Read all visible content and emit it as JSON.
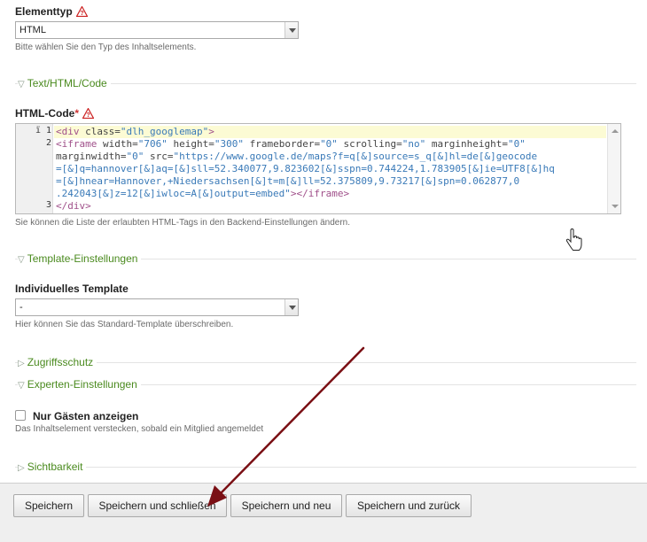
{
  "element_type": {
    "label": "Elementtyp",
    "value": "HTML",
    "help": "Bitte wählen Sie den Typ des Inhaltselements."
  },
  "sections": {
    "text_html": "Text/HTML/Code",
    "template": "Template-Einstellungen",
    "access": "Zugriffsschutz",
    "expert": "Experten-Einstellungen",
    "visibility": "Sichtbarkeit"
  },
  "html_code": {
    "label": "HTML-Code",
    "required_mark": "*",
    "help": "Sie können die Liste der erlaubten HTML-Tags in den Backend-Einstellungen ändern.",
    "gutter_marker": "ï 1",
    "line_numbers": [
      "2",
      "3"
    ]
  },
  "code": {
    "l1_open": "<div ",
    "l1_attr": "class=",
    "l1_val": "\"dlh_googlemap\"",
    "l1_close": ">",
    "l2a": "<iframe ",
    "l2b": "width=",
    "l2c": "\"706\"",
    "l2d": " height=",
    "l2e": "\"300\"",
    "l2f": " frameborder=",
    "l2g": "\"0\"",
    "l2h": " scrolling=",
    "l2i": "\"no\"",
    "l2j": " marginheight=",
    "l2k": "\"0\"",
    "l3a": "marginwidth=",
    "l3b": "\"0\"",
    "l3c": " src=",
    "l3d": "\"https://www.google.de/maps?f=q[&]source=s_q[&]hl=de[&]geocode",
    "l4": "=[&]q=hannover[&]aq=[&]sll=52.340077,9.823602[&]sspn=0.744224,1.783905[&]ie=UTF8[&]hq",
    "l5": "=[&]hnear=Hannover,+Niedersachsen[&]t=m[&]ll=52.375809,9.73217[&]spn=0.062877,0",
    "l6a": ".242043[&]z=12[&]iwloc=A[&]output=embed\"",
    "l6b": "></iframe>",
    "l7": "</div>"
  },
  "template": {
    "label": "Individuelles Template",
    "value": "-",
    "help": "Hier können Sie das Standard-Template überschreiben."
  },
  "guests": {
    "label": "Nur Gästen anzeigen",
    "help": "Das Inhaltselement verstecken, sobald ein Mitglied angemeldet"
  },
  "buttons": {
    "save": "Speichern",
    "save_close": "Speichern und schließen",
    "save_new": "Speichern und neu",
    "save_back": "Speichern und zurück"
  },
  "colors": {
    "legend_green": "#4a8a1e",
    "arrow": "#7a0f14",
    "warn": "#cc2222"
  }
}
